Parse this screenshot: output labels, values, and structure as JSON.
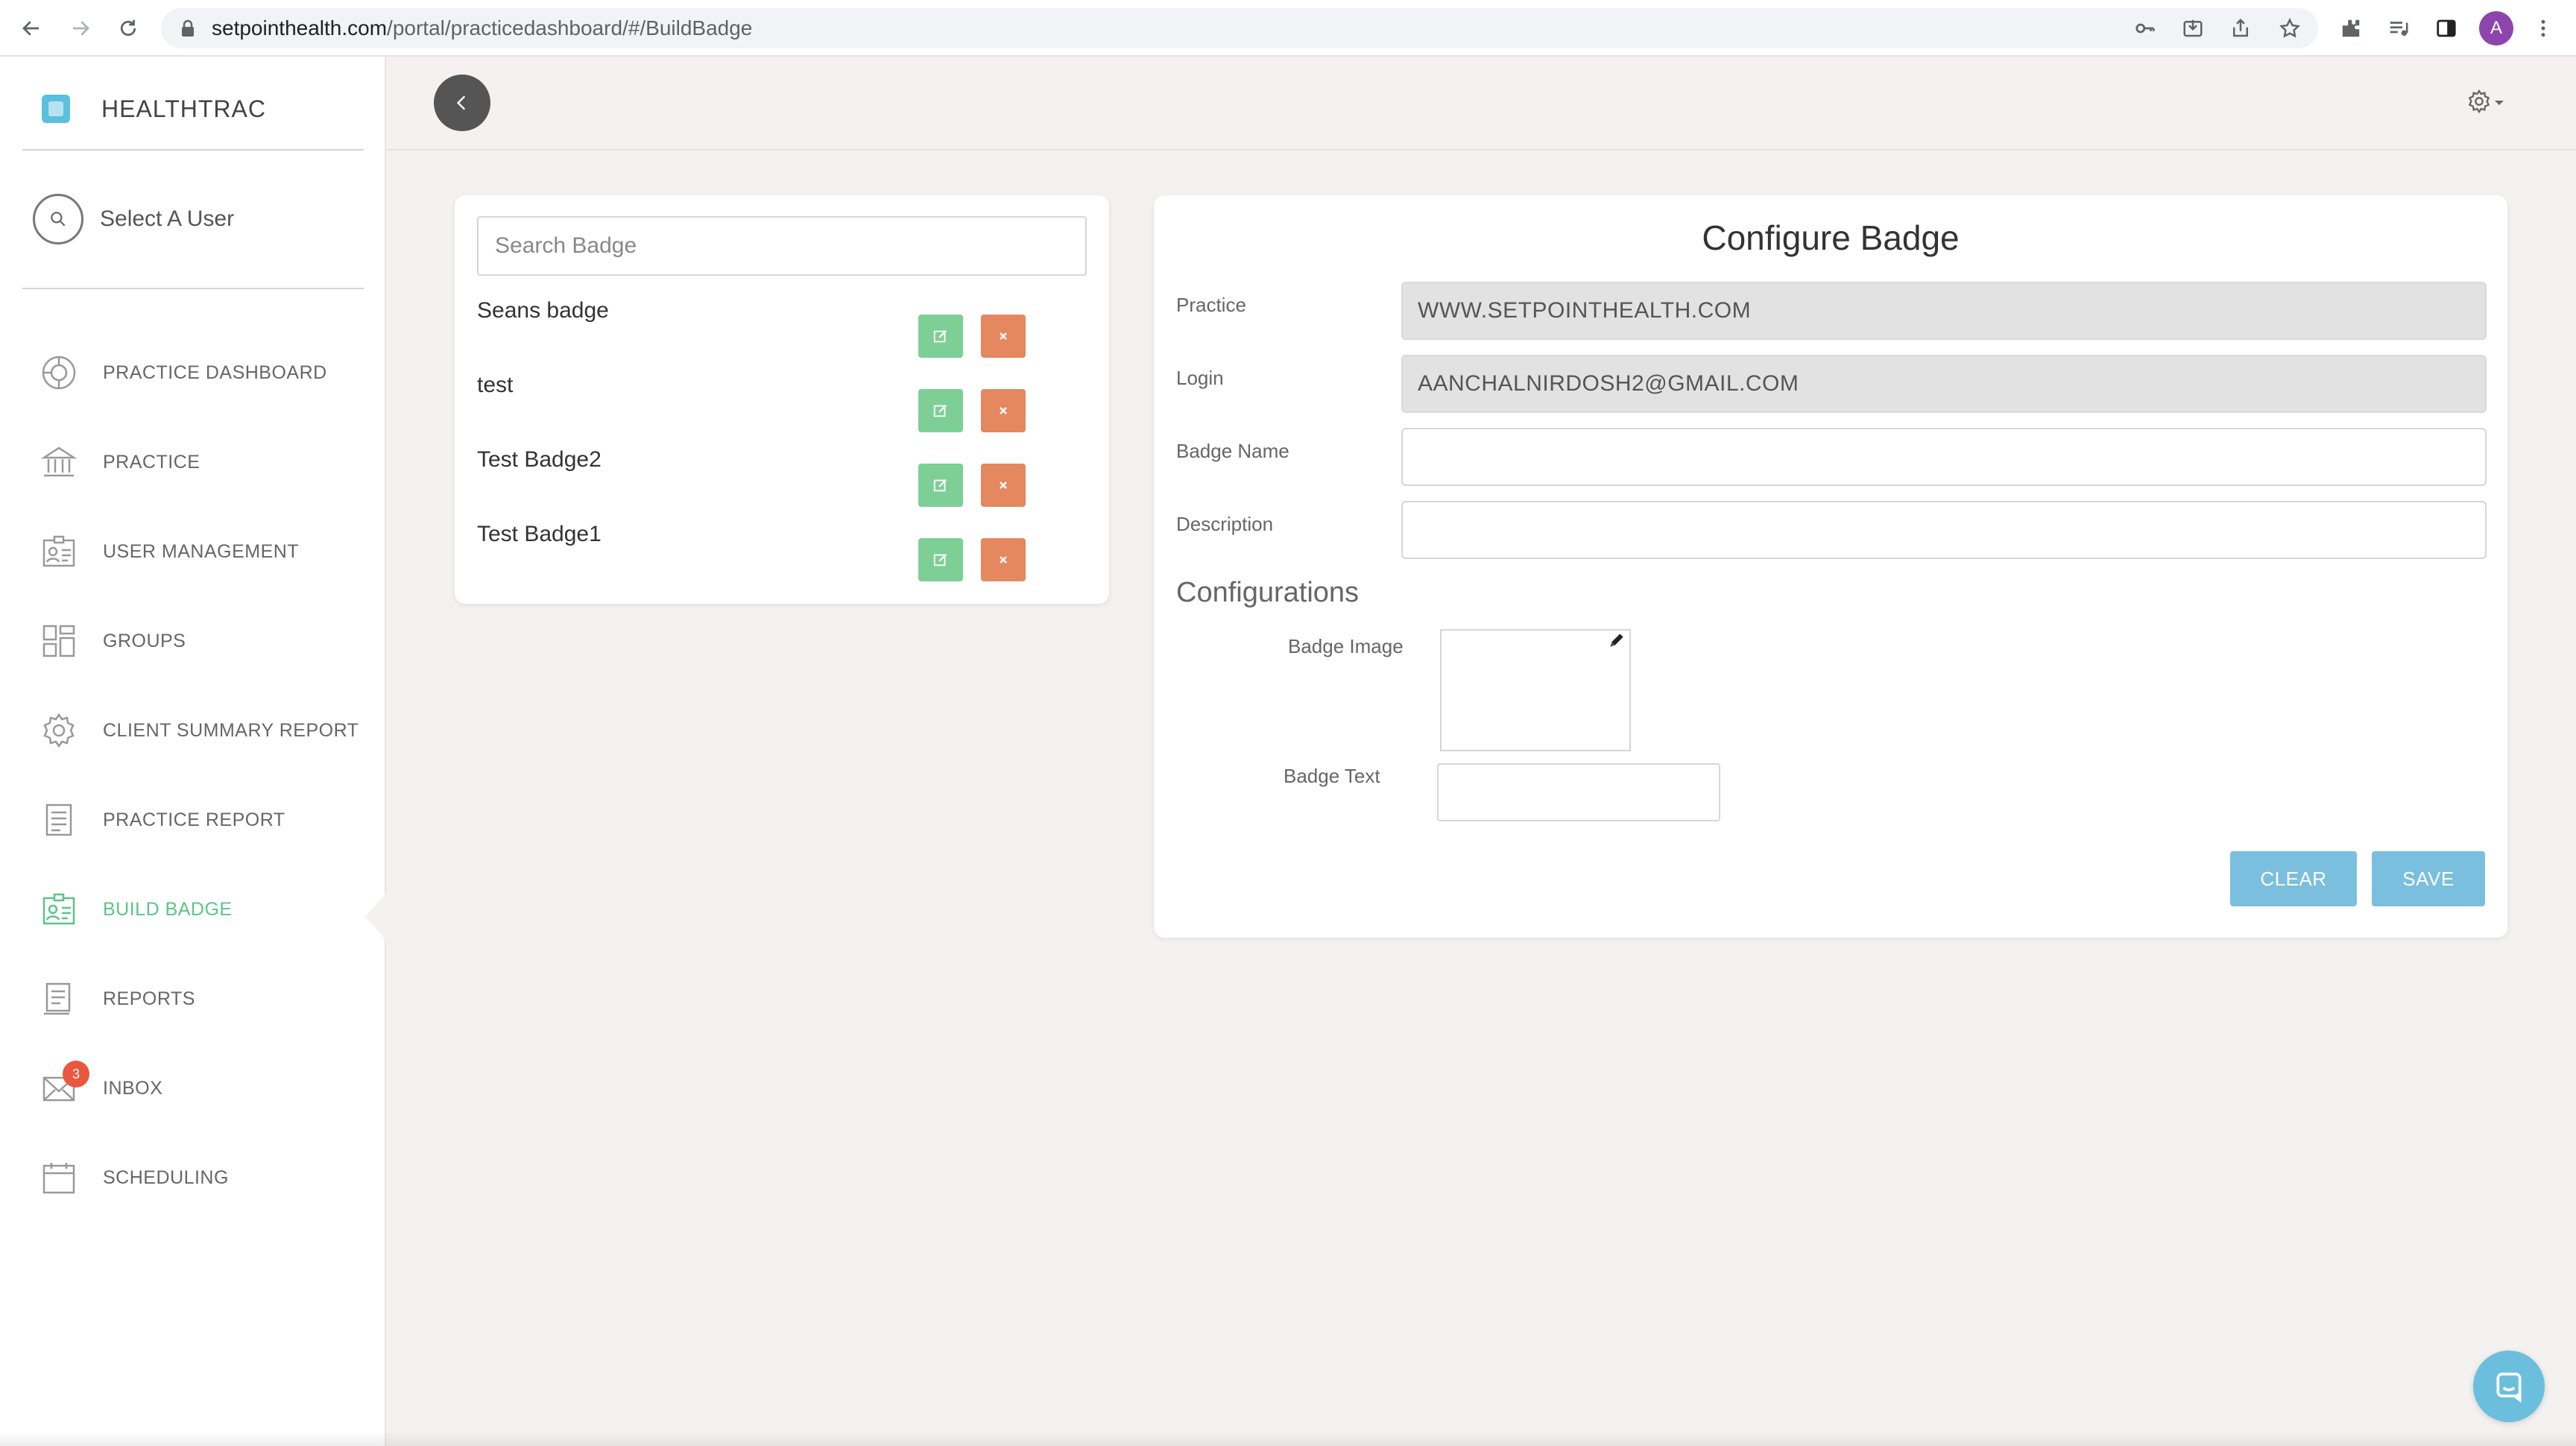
{
  "browser": {
    "url_host": "setpointhealth.com",
    "url_path": "/portal/practicedashboard/#/BuildBadge",
    "profile_initial": "A"
  },
  "sidebar": {
    "brand": "HEALTHTRAC",
    "select_user": "Select A User",
    "items": [
      {
        "label": "PRACTICE DASHBOARD",
        "icon": "dashboard-icon"
      },
      {
        "label": "PRACTICE",
        "icon": "building-icon"
      },
      {
        "label": "USER MANAGEMENT",
        "icon": "id-card-icon"
      },
      {
        "label": "GROUPS",
        "icon": "groups-icon"
      },
      {
        "label": "CLIENT SUMMARY REPORT",
        "icon": "gear-icon"
      },
      {
        "label": "PRACTICE REPORT",
        "icon": "document-icon"
      },
      {
        "label": "BUILD BADGE",
        "icon": "badge-card-icon",
        "active": true
      },
      {
        "label": "REPORTS",
        "icon": "reports-icon"
      },
      {
        "label": "INBOX",
        "icon": "mail-icon",
        "count": "3"
      },
      {
        "label": "SCHEDULING",
        "icon": "calendar-icon"
      }
    ]
  },
  "badge_list": {
    "search_placeholder": "Search Badge",
    "badges": [
      "Seans badge",
      "test",
      "Test Badge2",
      "Test Badge1"
    ]
  },
  "configure": {
    "title": "Configure Badge",
    "practice_label": "Practice",
    "practice_value": "WWW.SETPOINTHEALTH.COM",
    "login_label": "Login",
    "login_value": "AANCHALNIRDOSH2@GMAIL.COM",
    "badge_name_label": "Badge Name",
    "badge_name_value": "",
    "description_label": "Description",
    "description_value": "",
    "configurations_title": "Configurations",
    "badge_image_label": "Badge Image",
    "badge_text_label": "Badge Text",
    "clear_label": "CLEAR",
    "save_label": "SAVE"
  },
  "colors": {
    "accent_green": "#5cc48a",
    "edit_green": "#7dcf96",
    "delete_orange": "#e5875f",
    "button_blue": "#7bbfdf",
    "notification_red": "#e9573f"
  }
}
